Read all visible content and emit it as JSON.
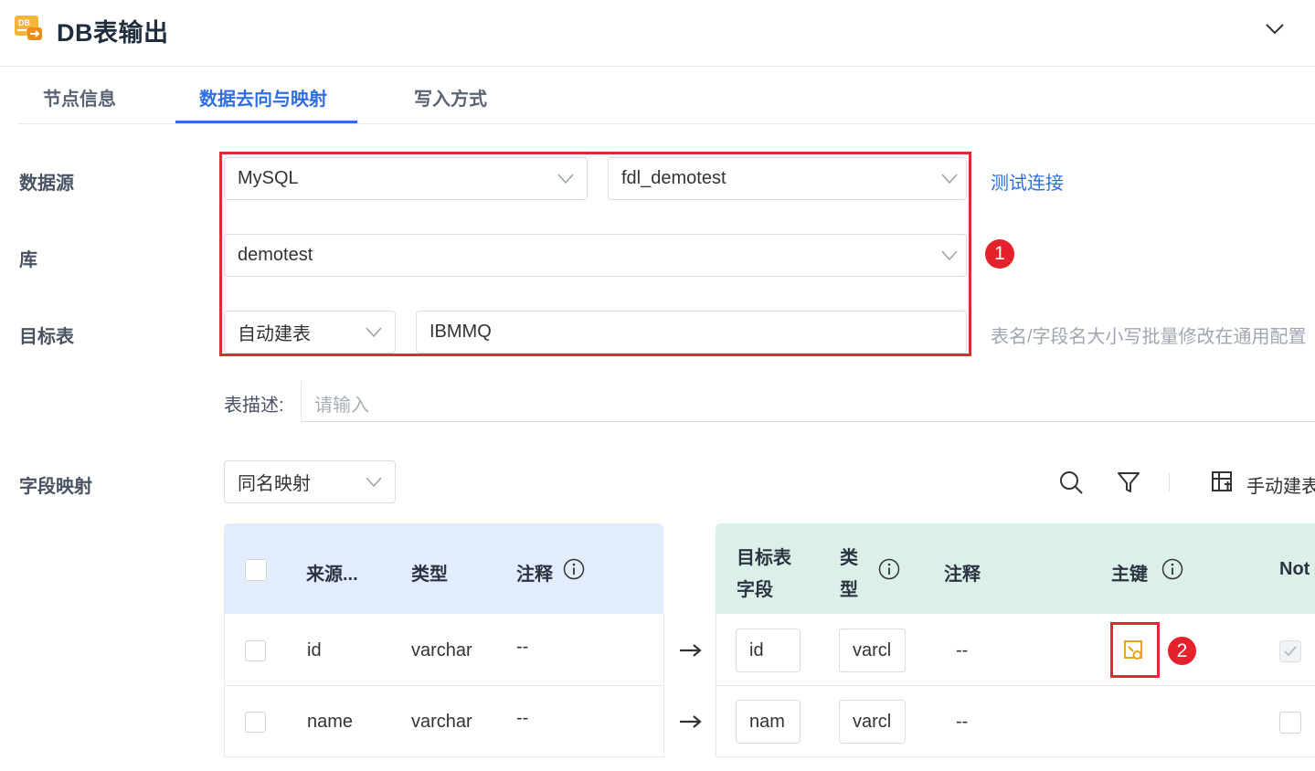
{
  "header": {
    "app_icon": "db-output-icon",
    "title": "DB表输出",
    "collapse_icon": "chevron-down-icon"
  },
  "tabs": [
    {
      "label": "节点信息",
      "active": false
    },
    {
      "label": "数据去向与映射",
      "active": true
    },
    {
      "label": "写入方式",
      "active": false
    }
  ],
  "form": {
    "datasource": {
      "label": "数据源",
      "type_value": "MySQL",
      "connection_value": "fdl_demotest",
      "test_link": "测试连接"
    },
    "database": {
      "label": "库",
      "value": "demotest"
    },
    "target_table": {
      "label": "目标表",
      "mode_value": "自动建表",
      "name_value": "IBMMQ",
      "hint": "表名/字段名大小写批量修改在通用配置"
    },
    "table_desc": {
      "label": "表描述:",
      "placeholder": "请输入"
    },
    "field_mapping": {
      "label": "字段映射",
      "mode_value": "同名映射",
      "manual_button": "手动建表"
    }
  },
  "badges": {
    "one": "1",
    "two": "2"
  },
  "table": {
    "source_headers": {
      "name": "来源...",
      "type": "类型",
      "comment": "注释"
    },
    "target_headers": {
      "field_line1": "目标表",
      "field_line2": "字段",
      "type_line1": "类",
      "type_line2": "型",
      "comment": "注释",
      "primary_key": "主键",
      "not_null": "Not"
    },
    "rows": [
      {
        "src_name": "id",
        "src_type": "varchar",
        "src_comment": "--",
        "tgt_name": "id",
        "tgt_type": "varcl",
        "tgt_comment": "--",
        "primary_key": true,
        "not_null": true
      },
      {
        "src_name": "name",
        "src_type": "varchar",
        "src_comment": "--",
        "tgt_name": "nam",
        "tgt_type": "varcl",
        "tgt_comment": "--",
        "primary_key": false,
        "not_null": false
      }
    ]
  },
  "colors": {
    "accent": "#2f6fe4",
    "highlight": "#e02b35",
    "source_header_bg": "#e3ecfb",
    "target_header_bg": "#dcf0ea",
    "key_icon": "#e8a21d"
  }
}
